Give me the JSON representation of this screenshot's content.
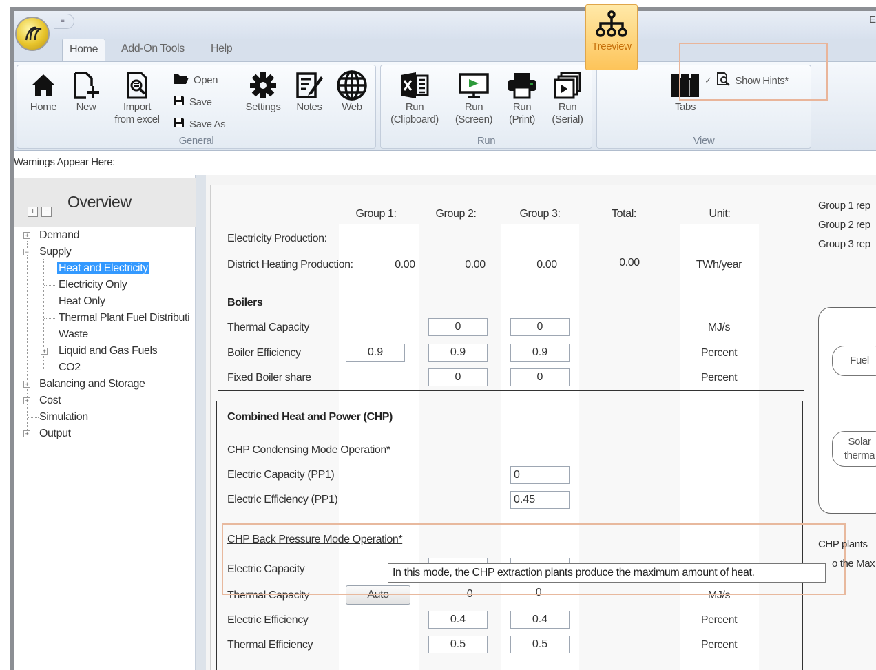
{
  "title_bar": {
    "qat_glyph": "≡",
    "right_text": "E"
  },
  "tabs": [
    {
      "label": "Home"
    },
    {
      "label": "Add-On Tools"
    },
    {
      "label": "Help"
    }
  ],
  "ribbon": {
    "general": {
      "label": "General",
      "home": "Home",
      "new": "New",
      "import": [
        "Import",
        "from excel"
      ],
      "open": "Open",
      "save": "Save",
      "save_as": "Save As",
      "settings": "Settings",
      "notes": "Notes",
      "web": "Web"
    },
    "run": {
      "label": "Run",
      "clipboard": [
        "Run",
        "(Clipboard)"
      ],
      "screen": [
        "Run",
        "(Screen)"
      ],
      "print": [
        "Run",
        "(Print)"
      ],
      "serial": [
        "Run",
        "(Serial)"
      ]
    },
    "view": {
      "label": "View",
      "treeview": "Treeview",
      "tabs": "Tabs",
      "show_hints": "Show Hints*",
      "show_hints_checked": true
    }
  },
  "warnings": "Warnings Appear Here:",
  "overview": {
    "title": "Overview",
    "expand_glyph": "+",
    "collapse_glyph": "−",
    "tree": {
      "demand": "Demand",
      "supply": "Supply",
      "heat_and_electricity": "Heat and Electricity",
      "electricity_only": "Electricity Only",
      "heat_only": "Heat Only",
      "thermal_plant": "Thermal Plant Fuel Distributi",
      "waste": "Waste",
      "liquid_gas": "Liquid and Gas Fuels",
      "co2": "CO2",
      "balancing": "Balancing and Storage",
      "cost": "Cost",
      "simulation": "Simulation",
      "output": "Output"
    }
  },
  "main": {
    "headers": {
      "group1": "Group 1:",
      "group2": "Group 2:",
      "group3": "Group 3:",
      "total": "Total:",
      "unit": "Unit:"
    },
    "production": {
      "electricity_label": "Electricity Production:",
      "district_label": "District Heating Production:",
      "g1": "0.00",
      "g2": "0.00",
      "g3": "0.00",
      "total": "0.00",
      "unit": "TWh/year"
    },
    "boilers": {
      "title": "Boilers",
      "thermal_capacity": {
        "label": "Thermal Capacity",
        "g2": "0",
        "g3": "0",
        "unit": "MJ/s"
      },
      "boiler_efficiency": {
        "label": "Boiler Efficiency",
        "g1": "0.9",
        "g2": "0.9",
        "g3": "0.9",
        "unit": "Percent"
      },
      "fixed_share": {
        "label": "Fixed Boiler share",
        "g2": "0",
        "g3": "0",
        "unit": "Percent"
      }
    },
    "chp": {
      "title": "Combined Heat and Power (CHP)",
      "condensing_link": "CHP Condensing Mode Operation*",
      "elec_capacity_pp1": {
        "label": "Electric Capacity (PP1)",
        "g3": "0"
      },
      "elec_efficiency_pp1": {
        "label": "Electric Efficiency (PP1)",
        "g3": "0.45"
      },
      "backpressure_link": "CHP Back Pressure Mode Operation*",
      "elec_capacity": {
        "label": "Electric Capacity"
      },
      "thermal_capacity": {
        "label": "Thermal Capacity",
        "auto": "Auto",
        "g2": "0",
        "g3": "0",
        "unit": "MJ/s"
      },
      "elec_efficiency": {
        "label": "Electric Efficiency",
        "g2": "0.4",
        "g3": "0.4",
        "unit": "Percent"
      },
      "thermal_efficiency": {
        "label": "Thermal Efficiency",
        "g2": "0.5",
        "g3": "0.5",
        "unit": "Percent"
      }
    },
    "tooltip": "In this mode, the CHP extraction plants produce the maximum amount of heat."
  },
  "right_panel": {
    "group1": "Group 1 rep",
    "group2": "Group 2 rep",
    "group3": "Group 3 rep",
    "fuel": "Fuel",
    "solar": [
      "Solar",
      "therma"
    ],
    "chp_plants": "CHP plants",
    "max_text": "o the Max f"
  }
}
